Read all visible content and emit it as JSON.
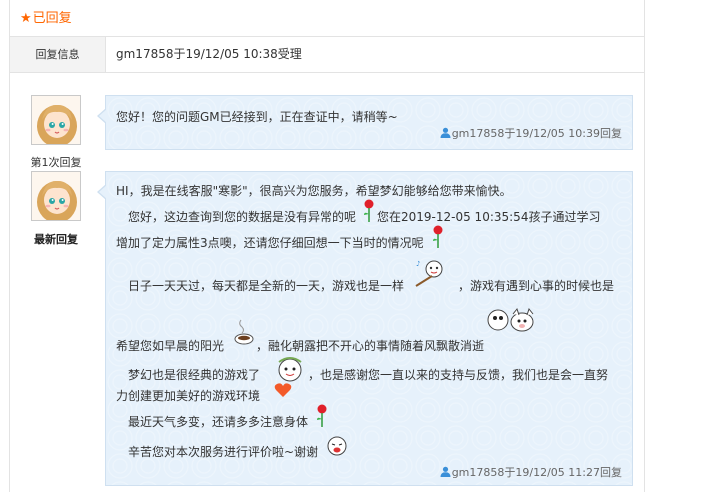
{
  "header": {
    "star": "★",
    "title": "已回复"
  },
  "info": {
    "label": "回复信息",
    "value": "gm17858于19/12/05 10:38受理"
  },
  "replies": [
    {
      "label": "第1次回复",
      "text": "您好！您的问题GM已经接到，正在查证中，请稍等~",
      "meta": "gm17858于19/12/05 10:39回复"
    },
    {
      "label": "最新回复",
      "lines": {
        "l1": "HI，我是在线客服\"寒影\"，很高兴为您服务，希望梦幻能够给您带来愉快。",
        "l2a": "您好，这边查询到您的数据是没有异常的呢",
        "l2b": "您在2019-12-05 10:35:54孩子通过学习",
        "l3": "增加了定力属性3点噢，还请您仔细回想一下当时的情况呢",
        "l4a": "日子一天天过，每天都是全新的一天，游戏也是一样",
        "l4b": "，游戏有遇到心事的时候也是",
        "l5a": "希望您如早晨的阳光",
        "l5b": "，融化朝露把不开心的事情随着风飘散消逝",
        "l6a": "梦幻也是很经典的游戏了",
        "l6b": "，也是感谢您一直以来的支持与反馈，我们也是会一直努",
        "l7": "力创建更加美好的游戏环境",
        "l8": "最近天气多变，还请多多注意身体",
        "l9": "辛苦您对本次服务进行评价啦~谢谢"
      },
      "meta": "gm17858于19/12/05 11:27回复"
    }
  ],
  "colors": {
    "accent": "#ff6600",
    "bubble": "#e6f1fb",
    "user_icon": "#3a8fd8"
  },
  "icons": [
    "star-icon",
    "user-icon",
    "rose-icon",
    "heart-icon",
    "coffee-icon",
    "emoticon"
  ]
}
